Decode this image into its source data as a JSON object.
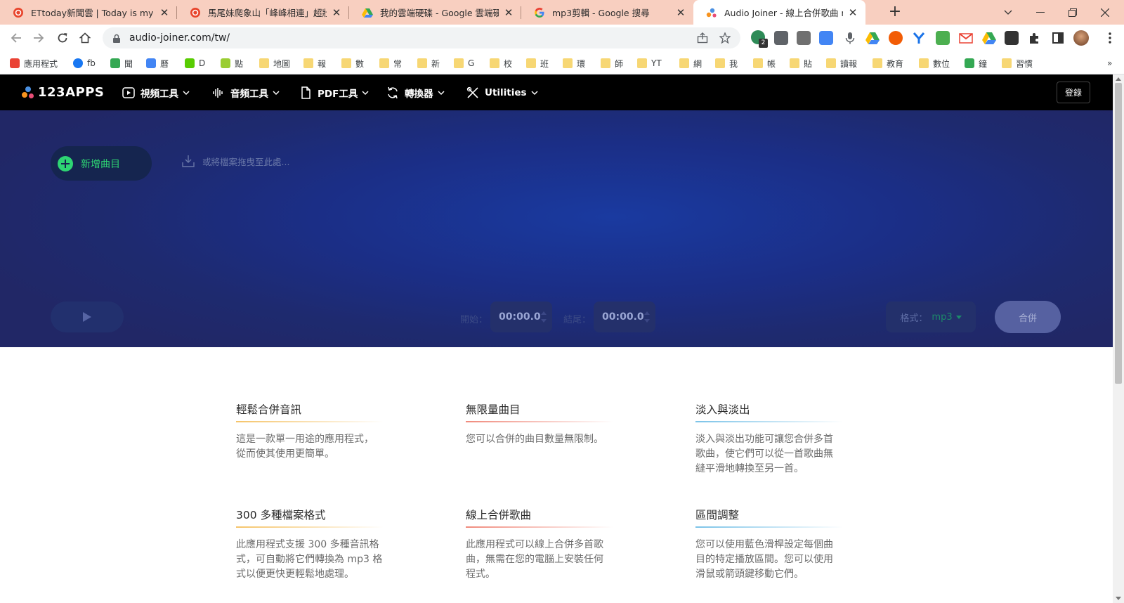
{
  "browser": {
    "tabs": [
      {
        "title": "ETtoday新聞雲 | Today is my da",
        "favicon": "ettoday-icon",
        "active": false
      },
      {
        "title": "馬尾妹爬象山「峰峰相連」超壯",
        "favicon": "ettoday-icon",
        "active": false
      },
      {
        "title": "我的雲端硬碟 - Google 雲端硬碟",
        "favicon": "google-drive-icon",
        "active": false
      },
      {
        "title": "mp3剪輯 - Google 搜尋",
        "favicon": "google-icon",
        "active": false
      },
      {
        "title": "Audio Joiner - 線上合併歌曲 mp",
        "favicon": "123apps-icon",
        "active": true
      }
    ],
    "tab_close_glyph": "✕",
    "new_tab_glyph": "+",
    "url": "audio-joiner.com/tw/",
    "extension_badge": "2",
    "bookmarks": [
      {
        "label": "應用程式",
        "icon": "apps-grid-icon"
      },
      {
        "label": "fb",
        "icon": "facebook-icon"
      },
      {
        "label": "聞",
        "icon": "green-diamond-icon"
      },
      {
        "label": "曆",
        "icon": "calendar-icon"
      },
      {
        "label": "D",
        "icon": "duolingo-icon"
      },
      {
        "label": "點",
        "icon": "yellow-face-icon"
      },
      {
        "label": "地圖",
        "icon": "folder-icon"
      },
      {
        "label": "報",
        "icon": "folder-icon"
      },
      {
        "label": "數",
        "icon": "folder-icon"
      },
      {
        "label": "常",
        "icon": "folder-icon"
      },
      {
        "label": "新",
        "icon": "folder-icon"
      },
      {
        "label": "G",
        "icon": "folder-icon"
      },
      {
        "label": "校",
        "icon": "folder-icon"
      },
      {
        "label": "班",
        "icon": "folder-icon"
      },
      {
        "label": "環",
        "icon": "folder-icon"
      },
      {
        "label": "師",
        "icon": "folder-icon"
      },
      {
        "label": "YT",
        "icon": "folder-icon"
      },
      {
        "label": "網",
        "icon": "folder-icon"
      },
      {
        "label": "我",
        "icon": "folder-icon"
      },
      {
        "label": "帳",
        "icon": "folder-icon"
      },
      {
        "label": "貼",
        "icon": "folder-icon"
      },
      {
        "label": "讀報",
        "icon": "folder-icon"
      },
      {
        "label": "教育",
        "icon": "folder-icon"
      },
      {
        "label": "數位",
        "icon": "folder-icon"
      },
      {
        "label": "鐘",
        "icon": "green-g-icon"
      },
      {
        "label": "習慣",
        "icon": "folder-icon"
      }
    ],
    "bookmarks_overflow": "»"
  },
  "app": {
    "logo_text": "123APPS",
    "nav": [
      {
        "label": "視頻工具",
        "icon": "video-play-icon"
      },
      {
        "label": "音頻工具",
        "icon": "audio-wave-icon"
      },
      {
        "label": "PDF工具",
        "icon": "pdf-file-icon"
      },
      {
        "label": "轉換器",
        "icon": "convert-arrows-icon"
      },
      {
        "label": "Utilities",
        "icon": "tools-icon"
      }
    ],
    "login_label": "登錄"
  },
  "editor": {
    "add_track_label": "新增曲目",
    "drop_hint": "或將檔案拖曳至此處...",
    "start_label": "開始：",
    "start_value": "00:00.0",
    "end_label": "結尾：",
    "end_value": "00:00.0",
    "format_label": "格式：",
    "format_value": "mp3",
    "merge_label": "合併"
  },
  "features": [
    {
      "title": "輕鬆合併音訊",
      "desc_lines": [
        "這是一款單一用途的應用程式，",
        "從而使其使用更簡單。"
      ],
      "accent": "#f5c469"
    },
    {
      "title": "無限量曲目",
      "desc_lines": [
        "您可以合併的曲目數量無限制。"
      ],
      "accent": "#f08a7c"
    },
    {
      "title": "淡入與淡出",
      "desc_lines": [
        "淡入與淡出功能可讓您合併多首",
        "歌曲，使它們可以從一首歌曲無",
        "縫平滑地轉換至另一首。"
      ],
      "accent": "#7bc3e8"
    },
    {
      "title": "300 多種檔案格式",
      "desc_lines": [
        "此應用程式支援 300 多種音訊格",
        "式，可自動將它們轉換為 mp3 格",
        "式以便更快更輕鬆地處理。"
      ],
      "accent": "#f5c469"
    },
    {
      "title": "線上合併歌曲",
      "desc_lines": [
        "此應用程式可以線上合併多首歌",
        "曲，無需在您的電腦上安裝任何",
        "程式。"
      ],
      "accent": "#f08a7c"
    },
    {
      "title": "區間調整",
      "desc_lines": [
        "您可以使用藍色滑桿設定每個曲",
        "目的特定播放區間。您可以使用",
        "滑鼠或箭頭鍵移動它們。"
      ],
      "accent": "#7bc3e8"
    }
  ],
  "colors": {
    "accent_green": "#2ed573",
    "tabstrip": "#f8cfc0",
    "hero_dark": "#1e2a6f",
    "nav_bg": "#000000"
  }
}
